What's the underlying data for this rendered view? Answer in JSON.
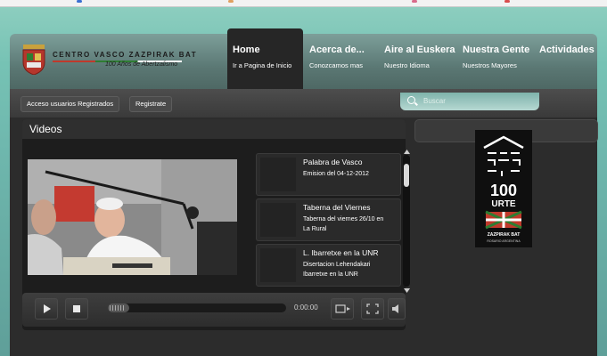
{
  "site": {
    "brand_title": "CENTRO VASCO ZAZPIRAK BAT",
    "brand_subtitle": "100 Años de Abertzalismo"
  },
  "nav": [
    {
      "title": "Home",
      "subtitle": "Ir a Pagina de Inicio",
      "active": true
    },
    {
      "title": "Acerca de...",
      "subtitle": "Conozcamos mas",
      "active": false
    },
    {
      "title": "Aire al Euskera",
      "subtitle": "Nuestro Idioma",
      "active": false
    },
    {
      "title": "Nuestra Gente",
      "subtitle": "Nuestros Mayores",
      "active": false
    },
    {
      "title": "Actividades",
      "subtitle": "",
      "active": false
    }
  ],
  "subbar": {
    "login_label": "Acceso usuarios Registrados",
    "register_label": "Registrate",
    "search_placeholder": "Buscar"
  },
  "videos": {
    "title": "Videos",
    "items": [
      {
        "title": "Palabra de Vasco",
        "desc": "Emision del 04-12-2012"
      },
      {
        "title": "Taberna del Viernes",
        "desc": "Taberna del viernes 26/10 en La Rural"
      },
      {
        "title": "L. Ibarretxe en la UNR",
        "desc": "Disertacion Lehendakari Ibarretxe en la UNR"
      }
    ],
    "player": {
      "time": "0:00:00",
      "progress": 0.12
    }
  },
  "banner": {
    "big_text": "100",
    "word": "URTE",
    "footer": "ZAZPIRAK BAT",
    "footer_sub": "ROSARIO ARGENTINA"
  },
  "icons": [
    "play-icon",
    "stop-icon",
    "playlist-icon",
    "fullscreen-icon",
    "volume-icon",
    "search-icon",
    "scroll-down-icon",
    "scroll-up-icon"
  ],
  "colors": {
    "nav_active": "#262626",
    "panel_bg": "#1d1d1d",
    "page_bg": "#76c2b4"
  }
}
